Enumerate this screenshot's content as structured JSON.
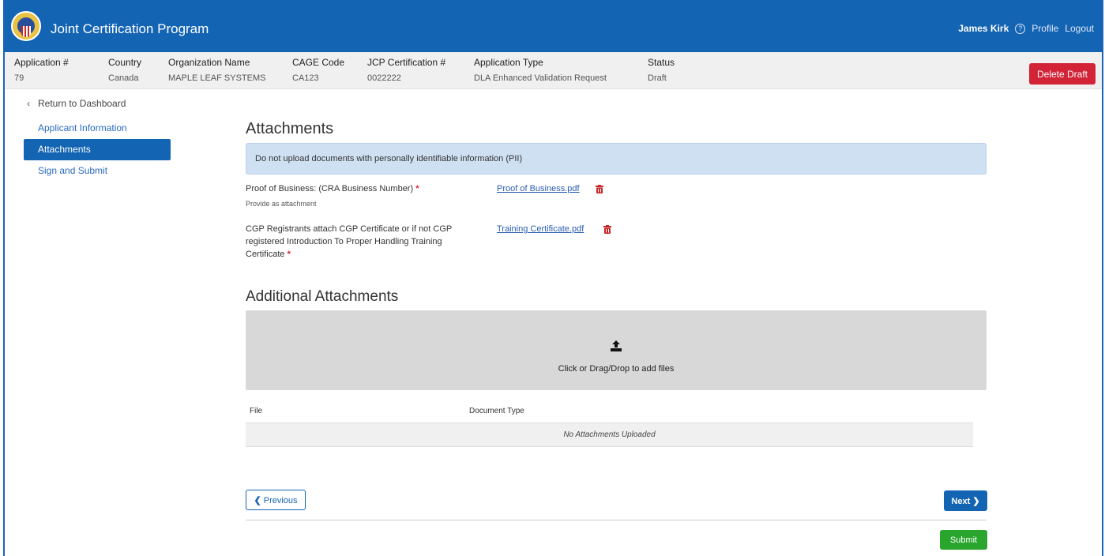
{
  "header": {
    "app_title": "Joint Certification Program",
    "user_name": "James Kirk",
    "help_glyph": "?",
    "profile": "Profile",
    "logout": "Logout"
  },
  "info": {
    "application_no": {
      "label": "Application #",
      "value": "79"
    },
    "country": {
      "label": "Country",
      "value": "Canada"
    },
    "organization": {
      "label": "Organization Name",
      "value": "MAPLE LEAF SYSTEMS"
    },
    "cage": {
      "label": "CAGE Code",
      "value": "CA123"
    },
    "jcp": {
      "label": "JCP Certification #",
      "value": "0022222"
    },
    "app_type": {
      "label": "Application Type",
      "value": "DLA Enhanced Validation Request"
    },
    "status": {
      "label": "Status",
      "value": "Draft"
    },
    "delete_button": "Delete Draft"
  },
  "sidebar": {
    "back": "Return to Dashboard",
    "items": [
      {
        "label": "Applicant Information"
      },
      {
        "label": "Attachments"
      },
      {
        "label": "Sign and Submit"
      }
    ]
  },
  "main": {
    "title": "Attachments",
    "alert": "Do not upload documents with personally identifiable information (PII)",
    "required": [
      {
        "label": "Proof of Business: (CRA Business Number)",
        "hint": "Provide as attachment",
        "file": "Proof of Business.pdf"
      },
      {
        "label_line1": "CGP Registrants attach CGP Certificate or if not CGP",
        "label_line2": "registered Introduction To Proper Handling Training",
        "label_line3": "Certificate",
        "file": "Training Certificate.pdf"
      }
    ],
    "required_marker": "*",
    "additional_title": "Additional Attachments",
    "dropzone_text": "Click or Drag/Drop to add files",
    "table": {
      "headers": [
        "File",
        "Document Type"
      ],
      "empty": "No Attachments Uploaded"
    },
    "prev_button": "Previous",
    "next_button": "Next",
    "submit_button": "Submit"
  },
  "colors": {
    "primary": "#1464b4",
    "danger": "#d32336",
    "success": "#2aa52e"
  }
}
